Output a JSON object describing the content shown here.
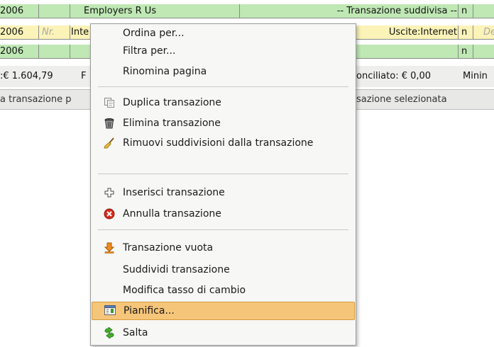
{
  "register": {
    "rows": [
      {
        "date": "2006",
        "num": "",
        "description": "Employers R Us",
        "transfer": "-- Transazione suddivisa --",
        "reconcile": "n",
        "amount": ""
      },
      {
        "date": "2006",
        "num": "Nr.",
        "description": "Inte",
        "transfer": "Uscite:Internet",
        "reconcile": "n",
        "amount": "De"
      },
      {
        "date": "2006",
        "num": "",
        "description": "",
        "transfer": "",
        "reconcile": "n",
        "amount": ""
      }
    ],
    "summary": {
      "present": ":€ 1.604,79",
      "future": "F",
      "reconciled": "onciliato: € 0,00",
      "minimum": "Minin"
    },
    "status": {
      "left": "a transazione p",
      "right": "sazione selezionata"
    }
  },
  "menu": {
    "groups": [
      [
        {
          "label": "Ordina per...",
          "icon": ""
        },
        {
          "label": "Filtra per...",
          "icon": ""
        },
        {
          "label": "Rinomina pagina",
          "icon": ""
        }
      ],
      [
        {
          "label": "Duplica transazione",
          "icon": "duplicate-icon"
        },
        {
          "label": "Elimina transazione",
          "icon": "trash-icon"
        },
        {
          "label": "Rimuovi suddivisioni dalla transazione",
          "icon": "broom-icon"
        }
      ],
      [
        {
          "label": "Inserisci transazione",
          "icon": "plus-icon"
        },
        {
          "label": "Annulla transazione",
          "icon": "cancel-icon"
        }
      ],
      [
        {
          "label": "Transazione vuota",
          "icon": "blank-transaction-icon"
        },
        {
          "label": "Suddividi transazione",
          "icon": ""
        },
        {
          "label": "Modifica tasso di cambio",
          "icon": ""
        },
        {
          "label": "Pianifica...",
          "icon": "schedule-icon",
          "highlighted": true
        },
        {
          "label": "Salta",
          "icon": "jump-icon"
        }
      ]
    ]
  },
  "colors": {
    "row_green": "#bfe8b4",
    "row_yellow": "#fbf3b8",
    "menu_highlight": "#f5c57a"
  }
}
